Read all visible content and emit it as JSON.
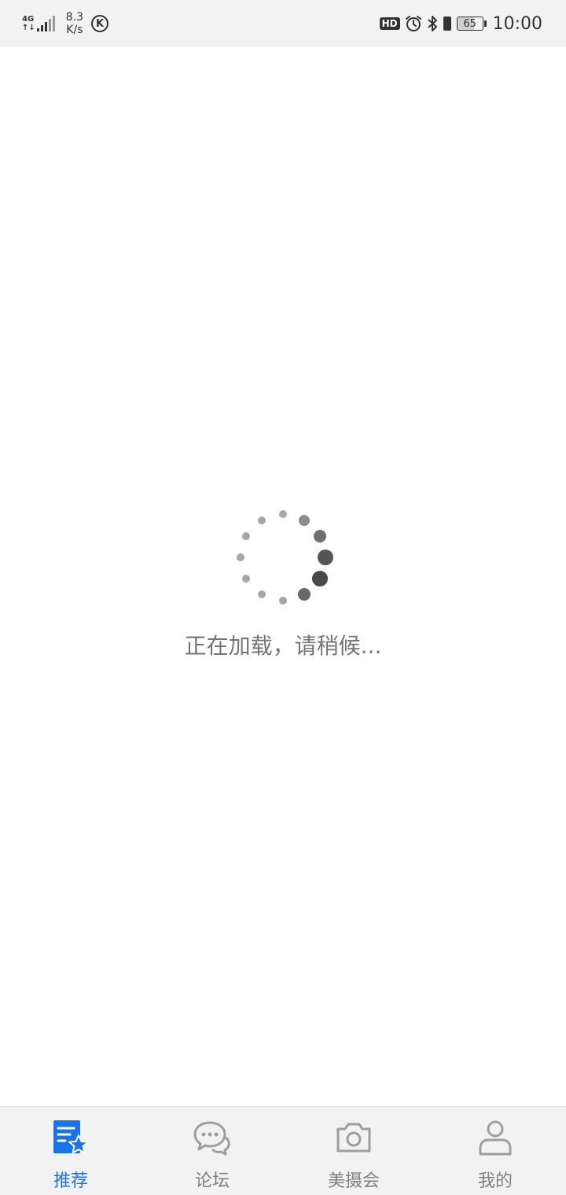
{
  "status_bar": {
    "network_type_top": "4G",
    "network_type_bottom": "↑↓",
    "speed_value": "8.3",
    "speed_unit": "K/s",
    "k_app_letter": "K",
    "hd_label": "HD",
    "battery_level": "65",
    "time": "10:00",
    "icons": [
      "signal-icon",
      "k-app-icon",
      "alarm-icon",
      "bluetooth-icon",
      "vibrate-icon",
      "battery-icon"
    ]
  },
  "loading": {
    "text": "正在加载，请稍候..."
  },
  "tab_bar": {
    "active_color": "#1a73e8",
    "inactive_color": "#808080",
    "tabs": [
      {
        "label": "推荐",
        "icon": "recommend-star-icon",
        "active": true
      },
      {
        "label": "论坛",
        "icon": "chat-bubbles-icon",
        "active": false
      },
      {
        "label": "美摄会",
        "icon": "camera-icon",
        "active": false
      },
      {
        "label": "我的",
        "icon": "person-icon",
        "active": false
      }
    ]
  }
}
